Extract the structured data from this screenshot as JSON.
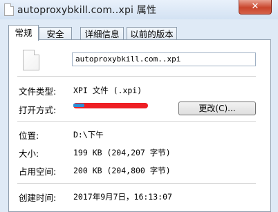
{
  "window": {
    "title": "autoproxybkill.com..xpi 属性",
    "close_label": "✕"
  },
  "tabs": [
    {
      "label": "常规",
      "active": true
    },
    {
      "label": "安全",
      "active": false
    },
    {
      "label": "详细信息",
      "active": false
    },
    {
      "label": "以前的版本",
      "active": false
    }
  ],
  "general": {
    "filename": "autoproxybkill.com..xpi",
    "file_type_label": "文件类型:",
    "file_type_value": "XPI 文件 (.xpi)",
    "open_with_label": "打开方式:",
    "change_button": "更改(C)...",
    "location_label": "位置:",
    "location_value": "D:\\下午",
    "size_label": "大小:",
    "size_value": "199 KB (204,207 字节)",
    "size_on_disk_label": "占用空间:",
    "size_on_disk_value": "200 KB (204,800 字节)",
    "created_label": "创建时间:",
    "created_value": "2017年9月7日，16:13:07"
  },
  "colors": {
    "redaction": "#ee1f24",
    "window_bg": "#dfeaf6"
  }
}
